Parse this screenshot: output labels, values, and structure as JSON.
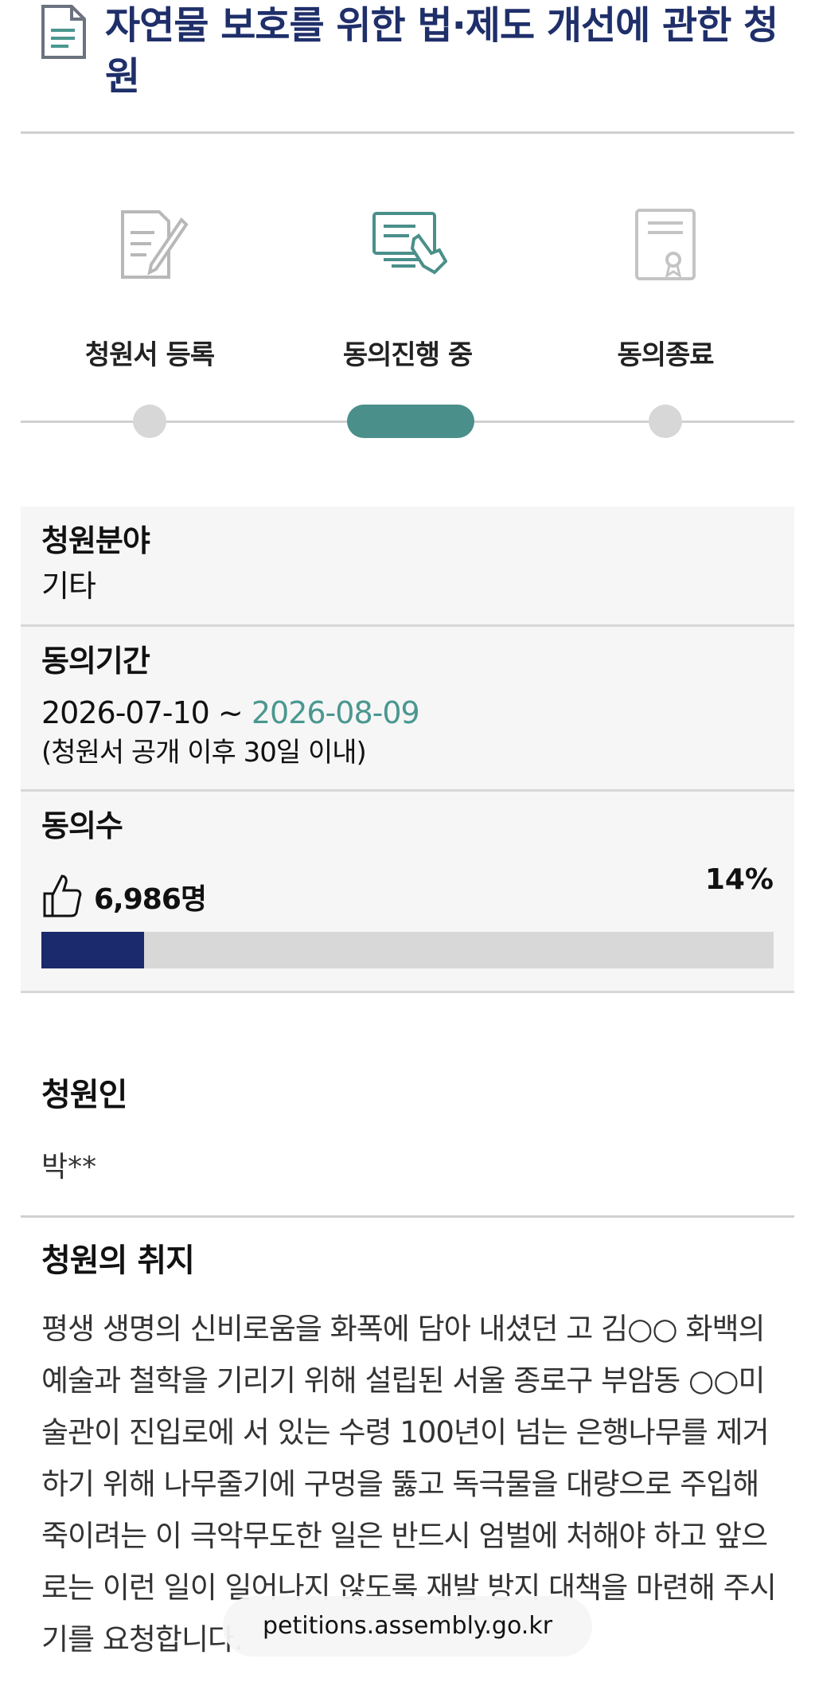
{
  "header": {
    "title": "자연물 보호를 위한 법·제도 개선에 관한 청원"
  },
  "steps": [
    {
      "label": "청원서 등록",
      "icon": "document-pen-icon",
      "state": "done"
    },
    {
      "label": "동의진행 중",
      "icon": "computer-hand-icon",
      "state": "active"
    },
    {
      "label": "동의종료",
      "icon": "certificate-icon",
      "state": "pending"
    }
  ],
  "info": {
    "field_label": "청원분야",
    "field_value": "기타",
    "period_label": "동의기간",
    "period_start": "2026-07-10 ~ ",
    "period_end": "2026-08-09",
    "period_note": "(청원서 공개 이후 30일 이내)",
    "count_label": "동의수",
    "count_value": "6,986명",
    "percent_text": "14%",
    "progress": 0.14
  },
  "petitioner": {
    "label": "청원인",
    "value": "박**"
  },
  "purpose": {
    "label": "청원의 취지",
    "text": "평생 생명의 신비로움을 화폭에 담아 내셨던 고 김○○ 화백의 예술과 철학을 기리기 위해 설립된 서울 종로구 부암동 ○○미술관이 진입로에 서 있는 수령 100년이 넘는 은행나무를 제거하기 위해 나무줄기에 구멍을 뚫고 독극물을 대량으로 주입해 죽이려는 이 극악무도한 일은 반드시 엄벌에 처해야 하고 앞으로는 이런 일이 일어나지 않도록 재발 방지 대책을 마련해 주시기를 요청합니다."
  },
  "browser": {
    "url": "petitions.assembly.go.kr"
  },
  "colors": {
    "title": "#1f2f6a",
    "accent": "#4a8f8a",
    "progress": "#1a2a6c"
  }
}
